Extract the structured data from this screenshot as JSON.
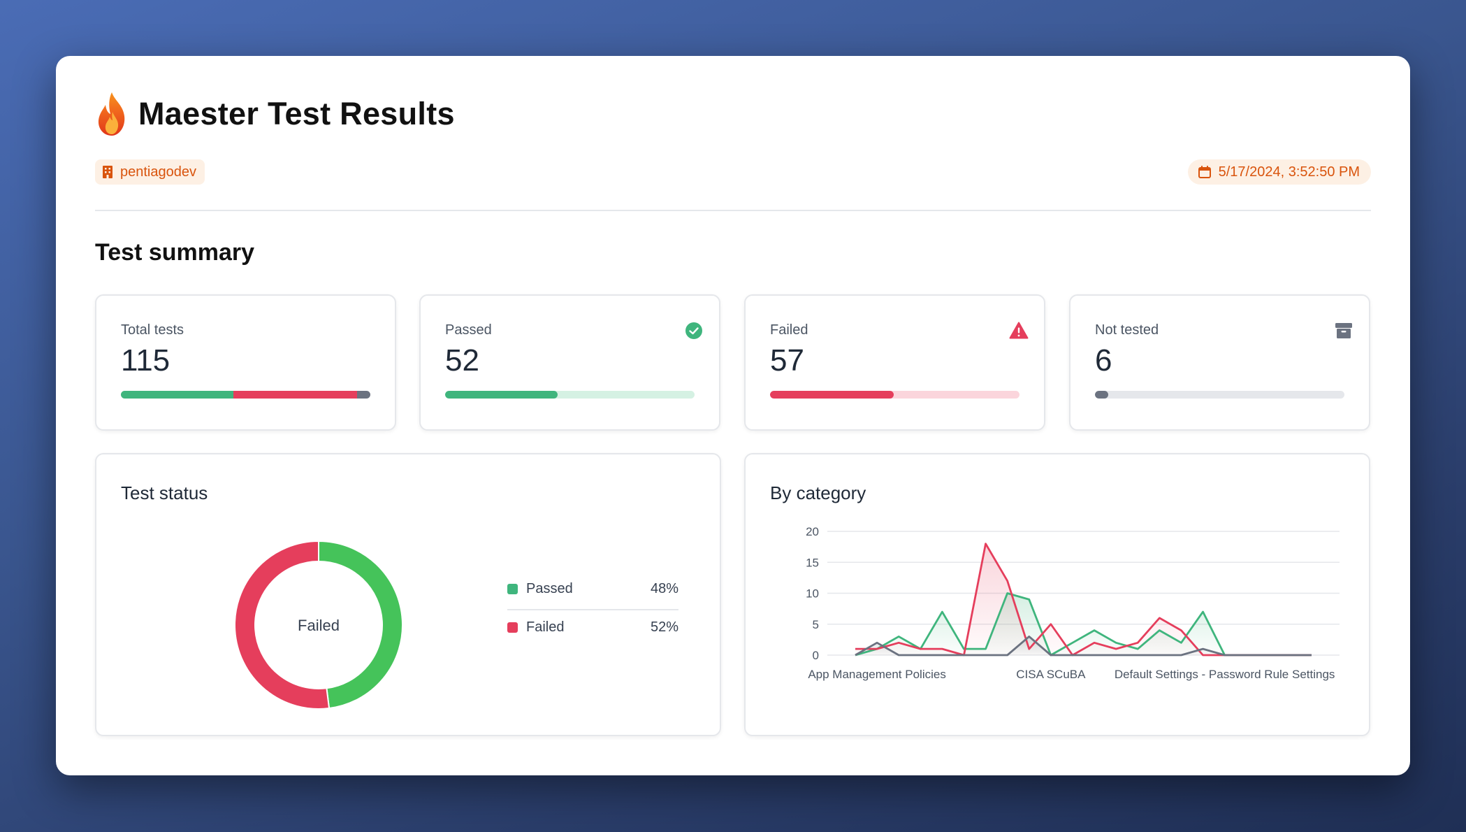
{
  "header": {
    "title": "Maester Test Results",
    "tenant": "pentiagodev",
    "datetime": "5/17/2024, 3:52:50 PM"
  },
  "summary": {
    "section_title": "Test summary",
    "total": {
      "label": "Total tests",
      "value": "115"
    },
    "passed": {
      "label": "Passed",
      "value": "52"
    },
    "failed": {
      "label": "Failed",
      "value": "57"
    },
    "not_tested": {
      "label": "Not tested",
      "value": "6"
    }
  },
  "colors": {
    "passed": "#3fb57d",
    "failed": "#e53e5c",
    "not_tested": "#6b7280",
    "accent": "#d9540d"
  },
  "icons": {
    "title": "flame-icon",
    "tenant": "building-icon",
    "date": "calendar-icon",
    "passed": "check-circle-icon",
    "failed": "warning-triangle-icon",
    "not_tested": "archive-icon"
  },
  "status_panel": {
    "title": "Test status",
    "center_label": "Failed",
    "legend": [
      {
        "label": "Passed",
        "pct": "48%"
      },
      {
        "label": "Failed",
        "pct": "52%"
      }
    ]
  },
  "category_panel": {
    "title": "By category"
  },
  "chart_data": [
    {
      "type": "pie",
      "title": "Test status",
      "categories": [
        "Passed",
        "Failed"
      ],
      "values": [
        48,
        52
      ],
      "colors": [
        "#45c35a",
        "#e53e5c"
      ],
      "center_label": "Failed"
    },
    {
      "type": "area",
      "title": "By category",
      "ylim": [
        0,
        20
      ],
      "yticks": [
        0,
        5,
        10,
        15,
        20
      ],
      "x_tick_labels": [
        "App Management Policies",
        "CISA SCuBA",
        "Default Settings - Password Rule Settings"
      ],
      "x_tick_positions": [
        2,
        10,
        18
      ],
      "x": [
        1,
        2,
        3,
        4,
        5,
        6,
        7,
        8,
        9,
        10,
        11,
        12,
        13,
        14,
        15,
        16,
        17,
        18,
        19,
        20,
        21,
        22
      ],
      "series": [
        {
          "values": [
            0,
            1,
            3,
            1,
            7,
            1,
            1,
            10,
            9,
            0,
            2,
            4,
            2,
            1,
            4,
            2,
            7,
            0,
            0,
            0,
            0,
            0
          ],
          "color": "#3fb57d"
        },
        {
          "values": [
            1,
            1,
            2,
            1,
            1,
            0,
            18,
            12,
            1,
            5,
            0,
            2,
            1,
            2,
            6,
            4,
            0,
            0,
            0,
            0,
            0,
            0
          ],
          "color": "#e53e5c"
        },
        {
          "values": [
            0,
            2,
            0,
            0,
            0,
            0,
            0,
            0,
            3,
            0,
            0,
            0,
            0,
            0,
            0,
            0,
            1,
            0,
            0,
            0,
            0,
            0
          ],
          "color": "#6b7280"
        }
      ]
    }
  ]
}
